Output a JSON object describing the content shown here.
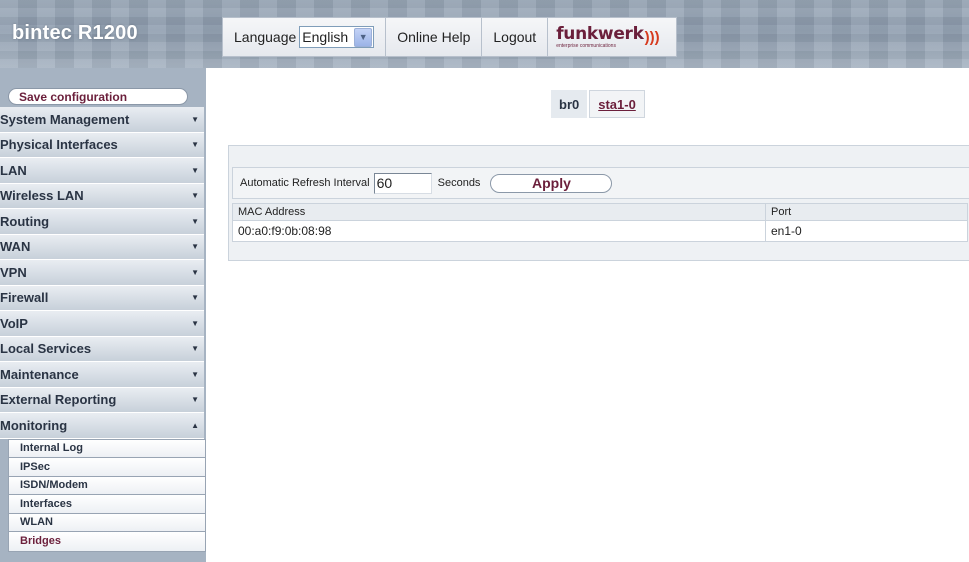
{
  "header": {
    "brand": "bintec R1200",
    "language_label": "Language",
    "language_value": "English",
    "online_help": "Online Help",
    "logout": "Logout",
    "logo_word": "funkwerk",
    "logo_tagline": "enterprise communications",
    "logo_waves": ")))"
  },
  "sidebar": {
    "save_configuration": "Save configuration",
    "menu": [
      {
        "label": "System Management",
        "caret": "▼"
      },
      {
        "label": "Physical Interfaces",
        "caret": "▼"
      },
      {
        "label": "LAN",
        "caret": "▼"
      },
      {
        "label": "Wireless LAN",
        "caret": "▼"
      },
      {
        "label": "Routing",
        "caret": "▼"
      },
      {
        "label": "WAN",
        "caret": "▼"
      },
      {
        "label": "VPN",
        "caret": "▼"
      },
      {
        "label": "Firewall",
        "caret": "▼"
      },
      {
        "label": "VoIP",
        "caret": "▼"
      },
      {
        "label": "Local Services",
        "caret": "▼"
      },
      {
        "label": "Maintenance",
        "caret": "▼"
      },
      {
        "label": "External Reporting",
        "caret": "▼"
      },
      {
        "label": "Monitoring",
        "caret": "▲"
      }
    ],
    "submenu": [
      {
        "label": "Internal Log"
      },
      {
        "label": "IPSec"
      },
      {
        "label": "ISDN/Modem"
      },
      {
        "label": "Interfaces"
      },
      {
        "label": "WLAN"
      },
      {
        "label": "Bridges",
        "active": true
      }
    ]
  },
  "main": {
    "tabs": [
      {
        "label": "br0",
        "active": true
      },
      {
        "label": "sta1-0",
        "active": false
      }
    ],
    "refresh": {
      "label": "Automatic Refresh Interval",
      "value": "60",
      "unit": "Seconds",
      "apply": "Apply"
    },
    "table": {
      "columns": [
        "MAC Address",
        "Port"
      ],
      "rows": [
        [
          "00:a0:f9:0b:08:98",
          "en1-0"
        ]
      ]
    }
  },
  "colors": {
    "accent": "#6b1f3b",
    "sidebar_bg": "#a6b3c2",
    "header_bg": "#8c9bad"
  }
}
